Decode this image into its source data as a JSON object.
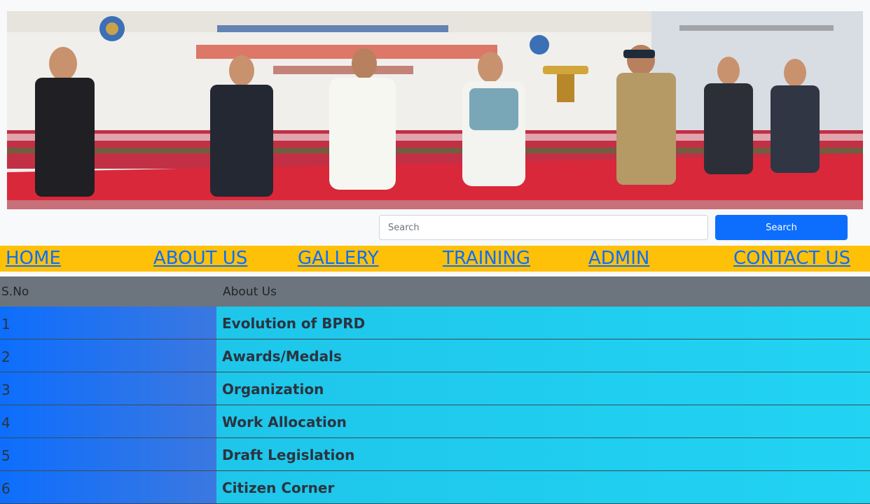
{
  "banner": {
    "alt": "award ceremony photo",
    "colors": {
      "sky": "#dfe6ee",
      "carpet": "#d9283a",
      "flowers": "#c23045",
      "stage_backdrop": "#f3f1ee"
    }
  },
  "search": {
    "placeholder": "Search",
    "button_label": "Search"
  },
  "nav": {
    "items": [
      {
        "label": "HOME"
      },
      {
        "label": "ABOUT US"
      },
      {
        "label": "GALLERY"
      },
      {
        "label": "TRAINING"
      },
      {
        "label": "ADMIN"
      },
      {
        "label": "CONTACT US"
      }
    ]
  },
  "table": {
    "headers": [
      "S.No",
      "About Us"
    ],
    "rows": [
      {
        "sn": "1",
        "title": "Evolution of BPRD"
      },
      {
        "sn": "2",
        "title": "Awards/Medals"
      },
      {
        "sn": "3",
        "title": "Organization"
      },
      {
        "sn": "4",
        "title": "Work Allocation"
      },
      {
        "sn": "5",
        "title": "Draft Legislation"
      },
      {
        "sn": "6",
        "title": "Citizen Corner"
      }
    ]
  },
  "colors": {
    "nav_bg": "#ffc107",
    "link": "#0d6efd",
    "header_bg": "#6c757d",
    "sn_col_bg": "#0d6efd",
    "title_col_bg": "#22d3f2",
    "button_bg": "#0d6efd"
  }
}
